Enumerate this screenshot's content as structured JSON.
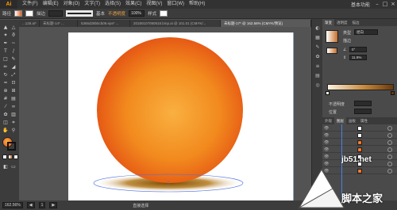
{
  "app": {
    "logo": "Ai"
  },
  "menubar": {
    "items": [
      "文件(F)",
      "编辑(E)",
      "对象(O)",
      "文字(T)",
      "选择(S)",
      "效果(C)",
      "视图(V)",
      "窗口(W)",
      "帮助(H)"
    ],
    "workspace": "基本功能"
  },
  "controlbar": {
    "label": "路径",
    "stroke_label": "描边",
    "stroke_value": "基本",
    "opacity_label": "不透明度",
    "opacity_value": "100%",
    "style_label": "样式"
  },
  "tabs": [
    {
      "label": "...128.ai*",
      "active": false
    },
    {
      "label": "未标题-14* ...",
      "active": false
    },
    {
      "label": "5365d28b5cb09.eps* ...",
      "active": false
    },
    {
      "label": "20180107090918.bmp.ai @ 101.01 (CMYK/...",
      "active": false
    },
    {
      "label": "未标题-17* @ 162.56% (CMYK/预览)",
      "active": true
    }
  ],
  "statusbar": {
    "zoom": "162.56%",
    "page": "1",
    "tool": "直接选择"
  },
  "rpanel": {
    "tabs": [
      "渐变",
      "透明度",
      "描边"
    ],
    "type_label": "类型",
    "type_value": "径向",
    "stroke_label": "描边",
    "angle_value": "0°",
    "aspect_value": "11.9%",
    "opacity_label": "不透明度",
    "position_label": "位置"
  },
  "layers": {
    "tabs": [
      "外观",
      "图层",
      "画板",
      "属性"
    ]
  },
  "watermark": {
    "site": "jb51.net",
    "name": "脚本之家"
  }
}
